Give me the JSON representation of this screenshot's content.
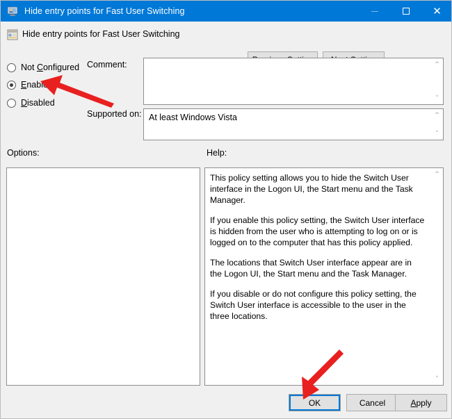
{
  "window": {
    "title": "Hide entry points for Fast User Switching",
    "icon": "monitor-user-icon",
    "controls": {
      "minimize": "minimize-icon",
      "maximize": "maximize-icon",
      "close": "close-icon"
    }
  },
  "header": {
    "icon": "policy-setting-icon",
    "title": "Hide entry points for Fast User Switching",
    "previous_setting": "Previous Setting",
    "previous_setting_accel": "P",
    "next_setting": "Next Setting",
    "next_setting_accel": "N"
  },
  "state": {
    "options": [
      {
        "label": "Not Configured",
        "accel": "C",
        "selected": false
      },
      {
        "label": "Enabled",
        "accel": "E",
        "selected": true
      },
      {
        "label": "Disabled",
        "accel": "D",
        "selected": false
      }
    ]
  },
  "comment": {
    "label": "Comment:",
    "value": "",
    "placeholder": ""
  },
  "supported": {
    "label": "Supported on:",
    "value": "At least Windows Vista"
  },
  "options_panel": {
    "label": "Options:",
    "content": ""
  },
  "help_panel": {
    "label": "Help:",
    "paragraphs": [
      "This policy setting allows you to hide the Switch User interface in the Logon UI, the Start menu and the Task Manager.",
      "If you enable this policy setting, the Switch User interface is hidden from the user who is attempting to log on or is logged on to the computer that has this policy applied.",
      "The locations that Switch User interface appear are in the Logon UI, the Start menu and the Task Manager.",
      "If you disable or do not configure this policy setting, the Switch User interface is accessible to the user in the three locations."
    ]
  },
  "footer": {
    "ok": "OK",
    "cancel": "Cancel",
    "apply": "Apply",
    "apply_accel": "A"
  },
  "annotations": [
    {
      "name": "arrow-pointing-to-enabled",
      "color": "#e8201f"
    },
    {
      "name": "arrow-pointing-to-ok",
      "color": "#e8201f"
    }
  ],
  "colors": {
    "titlebar": "#0078d7",
    "dialog_background": "#f0f0f0",
    "field_background": "#ffffff",
    "annotation_red": "#e8201f",
    "focus_blue": "#0078d7"
  }
}
